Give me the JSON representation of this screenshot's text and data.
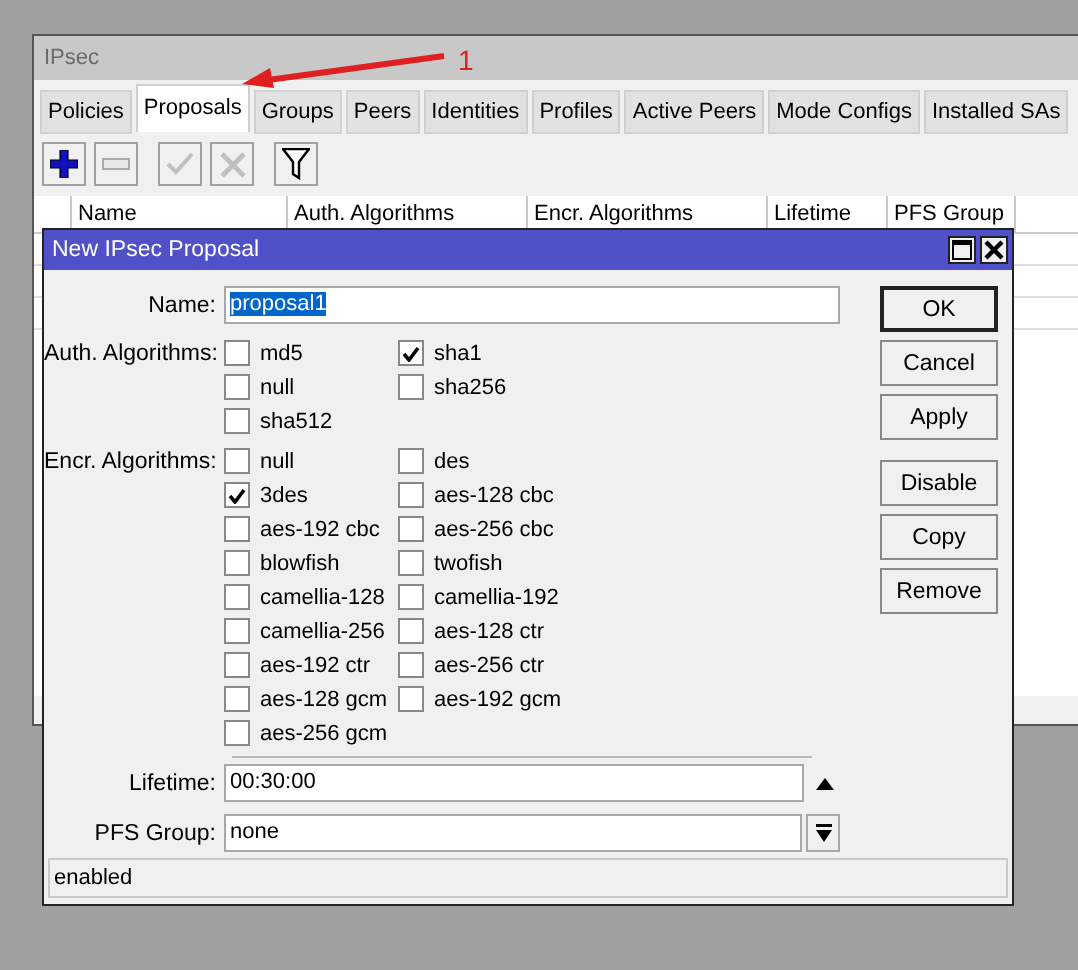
{
  "main_window": {
    "title": "IPsec",
    "tabs": [
      {
        "label": "Policies",
        "selected": false
      },
      {
        "label": "Proposals",
        "selected": true
      },
      {
        "label": "Groups",
        "selected": false
      },
      {
        "label": "Peers",
        "selected": false
      },
      {
        "label": "Identities",
        "selected": false
      },
      {
        "label": "Profiles",
        "selected": false
      },
      {
        "label": "Active Peers",
        "selected": false
      },
      {
        "label": "Mode Configs",
        "selected": false
      },
      {
        "label": "Installed SAs",
        "selected": false
      }
    ],
    "toolbar": [
      {
        "kind": "add",
        "disabled": false
      },
      {
        "kind": "remove",
        "disabled": true
      },
      {
        "kind": "enable",
        "disabled": true
      },
      {
        "kind": "disable",
        "disabled": true
      },
      {
        "kind": "filter",
        "disabled": false
      }
    ],
    "table": {
      "columns": [
        "Name",
        "Auth. Algorithms",
        "Encr. Algorithms",
        "Lifetime",
        "PFS Group"
      ]
    }
  },
  "annotation": {
    "label": "1"
  },
  "dialog": {
    "title": "New IPsec Proposal",
    "name": {
      "label": "Name:",
      "value": "proposal1"
    },
    "auth": {
      "label": "Auth. Algorithms:",
      "options": [
        {
          "label": "md5",
          "checked": false
        },
        {
          "label": "sha1",
          "checked": true
        },
        {
          "label": "null",
          "checked": false
        },
        {
          "label": "sha256",
          "checked": false
        },
        {
          "label": "sha512",
          "checked": false
        }
      ]
    },
    "encr": {
      "label": "Encr. Algorithms:",
      "options": [
        {
          "label": "null",
          "checked": false
        },
        {
          "label": "des",
          "checked": false
        },
        {
          "label": "3des",
          "checked": true
        },
        {
          "label": "aes-128 cbc",
          "checked": false
        },
        {
          "label": "aes-192 cbc",
          "checked": false
        },
        {
          "label": "aes-256 cbc",
          "checked": false
        },
        {
          "label": "blowfish",
          "checked": false
        },
        {
          "label": "twofish",
          "checked": false
        },
        {
          "label": "camellia-128",
          "checked": false
        },
        {
          "label": "camellia-192",
          "checked": false
        },
        {
          "label": "camellia-256",
          "checked": false
        },
        {
          "label": "aes-128 ctr",
          "checked": false
        },
        {
          "label": "aes-192 ctr",
          "checked": false
        },
        {
          "label": "aes-256 ctr",
          "checked": false
        },
        {
          "label": "aes-128 gcm",
          "checked": false
        },
        {
          "label": "aes-192 gcm",
          "checked": false
        },
        {
          "label": "aes-256 gcm",
          "checked": false
        }
      ]
    },
    "lifetime": {
      "label": "Lifetime:",
      "value": "00:30:00"
    },
    "pfs_group": {
      "label": "PFS Group:",
      "value": "none"
    },
    "button_groups": [
      [
        {
          "label": "OK",
          "default": true
        },
        {
          "label": "Cancel",
          "default": false
        },
        {
          "label": "Apply",
          "default": false
        }
      ],
      [
        {
          "label": "Disable",
          "default": false
        },
        {
          "label": "Copy",
          "default": false
        },
        {
          "label": "Remove",
          "default": false
        }
      ]
    ],
    "status": "enabled"
  }
}
